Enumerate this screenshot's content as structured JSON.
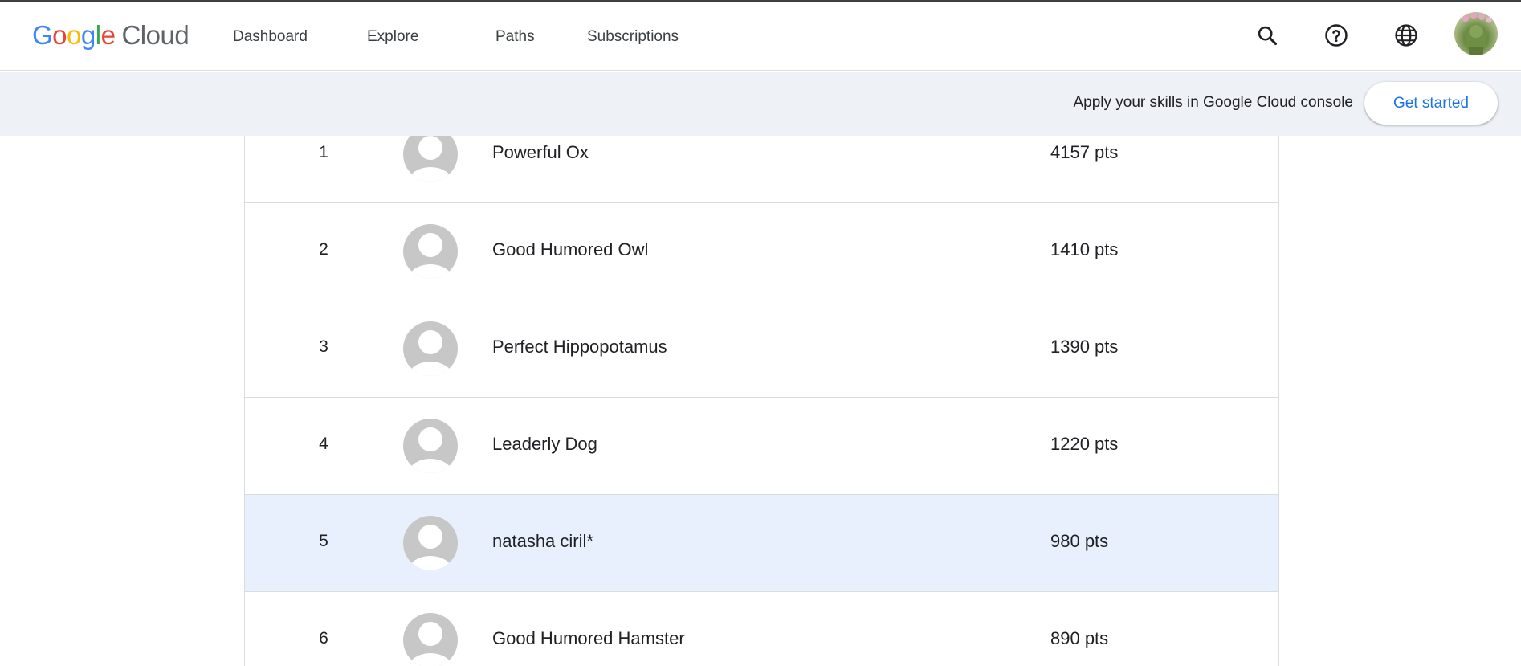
{
  "header": {
    "logo_letters": [
      "G",
      "o",
      "o",
      "g",
      "l",
      "e"
    ],
    "logo_suffix": "Cloud",
    "nav": [
      "Dashboard",
      "Explore",
      "Paths",
      "Subscriptions"
    ],
    "icons": [
      "search-icon",
      "help-icon",
      "language-globe-icon",
      "user-avatar"
    ]
  },
  "banner": {
    "text": "Apply your skills in Google Cloud console",
    "button": "Get started"
  },
  "leaderboard": {
    "rows": [
      {
        "rank": "1",
        "name": "Powerful Ox",
        "points": "4157 pts",
        "highlight": false
      },
      {
        "rank": "2",
        "name": "Good Humored Owl",
        "points": "1410 pts",
        "highlight": false
      },
      {
        "rank": "3",
        "name": "Perfect Hippopotamus",
        "points": "1390 pts",
        "highlight": false
      },
      {
        "rank": "4",
        "name": "Leaderly Dog",
        "points": "1220 pts",
        "highlight": false
      },
      {
        "rank": "5",
        "name": "natasha ciril*",
        "points": "980 pts",
        "highlight": true
      },
      {
        "rank": "6",
        "name": "Good Humored Hamster",
        "points": "890 pts",
        "highlight": false
      }
    ]
  },
  "colors": {
    "accent": "#1a73e8",
    "banner_bg": "#eef2f7",
    "highlight_row": "#e8f0fe",
    "avatar_placeholder": "#c7c7c7"
  }
}
